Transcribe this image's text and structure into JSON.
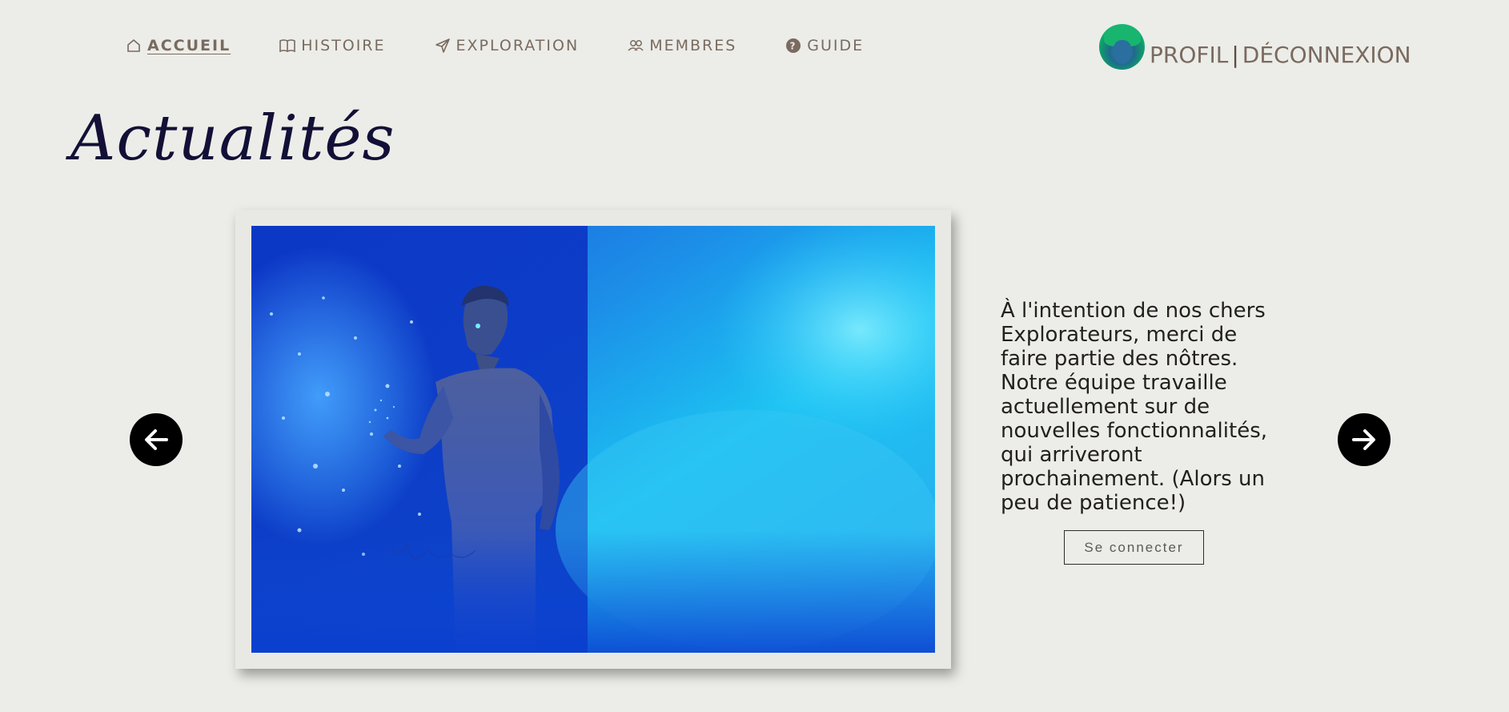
{
  "nav": {
    "items": [
      {
        "label": "ACCUEIL",
        "icon": "home-icon",
        "active": true
      },
      {
        "label": "HISTOIRE",
        "icon": "book-icon"
      },
      {
        "label": "EXPLORATION",
        "icon": "paper-plane-icon"
      },
      {
        "label": "MEMBRES",
        "icon": "users-icon"
      },
      {
        "label": "GUIDE",
        "icon": "question-circle-icon"
      }
    ]
  },
  "profile": {
    "profile_label": "PROFIL",
    "separator": "|",
    "logout_label": "DÉCONNEXION"
  },
  "page": {
    "title": "Actualités"
  },
  "slide": {
    "text": "À l'intention de nos chers Explorateurs, merci de faire partie des nôtres. Notre équipe travaille actuellement sur de nouvelles fonctionnalités, qui arriveront prochainement. (Alors un peu de patience!)",
    "button_label": "Se connecter"
  },
  "colors": {
    "background": "#ecede8",
    "nav_text": "#7a6a60",
    "title": "#131037",
    "arrow": "#000000"
  }
}
